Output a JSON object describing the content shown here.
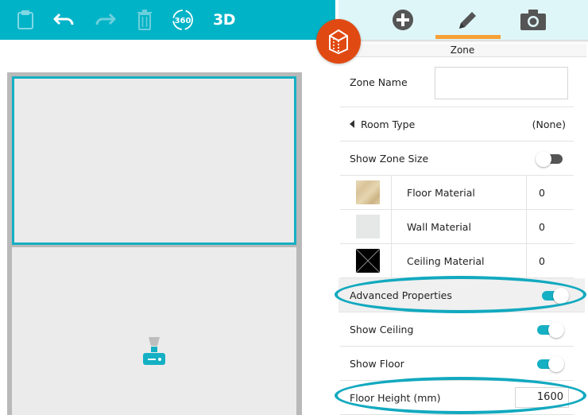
{
  "toolbar": {
    "buttons": [
      {
        "name": "paste-icon"
      },
      {
        "name": "undo-icon"
      },
      {
        "name": "redo-icon"
      },
      {
        "name": "trash-icon"
      },
      {
        "name": "view-360-icon",
        "label": "360"
      },
      {
        "name": "view-3d-button",
        "label": "3D"
      }
    ]
  },
  "tabs": [
    {
      "name": "add-icon",
      "active": false
    },
    {
      "name": "pencil-icon",
      "active": true
    },
    {
      "name": "camera-icon",
      "active": false
    }
  ],
  "panel": {
    "title": "Zone",
    "zone_name": {
      "label": "Zone Name",
      "value": ""
    },
    "room_type": {
      "label": "Room Type",
      "value": "(None)"
    },
    "show_zone_size": {
      "label": "Show Zone Size",
      "on": false
    },
    "materials": [
      {
        "label": "Floor Material",
        "value": "0",
        "swatch": "wood"
      },
      {
        "label": "Wall Material",
        "value": "0",
        "swatch": "plain"
      },
      {
        "label": "Ceiling Material",
        "value": "0",
        "swatch": "none"
      }
    ],
    "advanced_properties": {
      "label": "Advanced Properties",
      "on": true
    },
    "show_ceiling": {
      "label": "Show Ceiling",
      "on": true
    },
    "show_floor": {
      "label": "Show Floor",
      "on": true
    },
    "floor_height": {
      "label": "Floor Height (mm)",
      "value": "1600"
    }
  },
  "colors": {
    "toolbar": "#00b3c7",
    "accent": "#15b0c3",
    "fab": "#e04a12",
    "active_tab_bar": "#f7a035"
  }
}
